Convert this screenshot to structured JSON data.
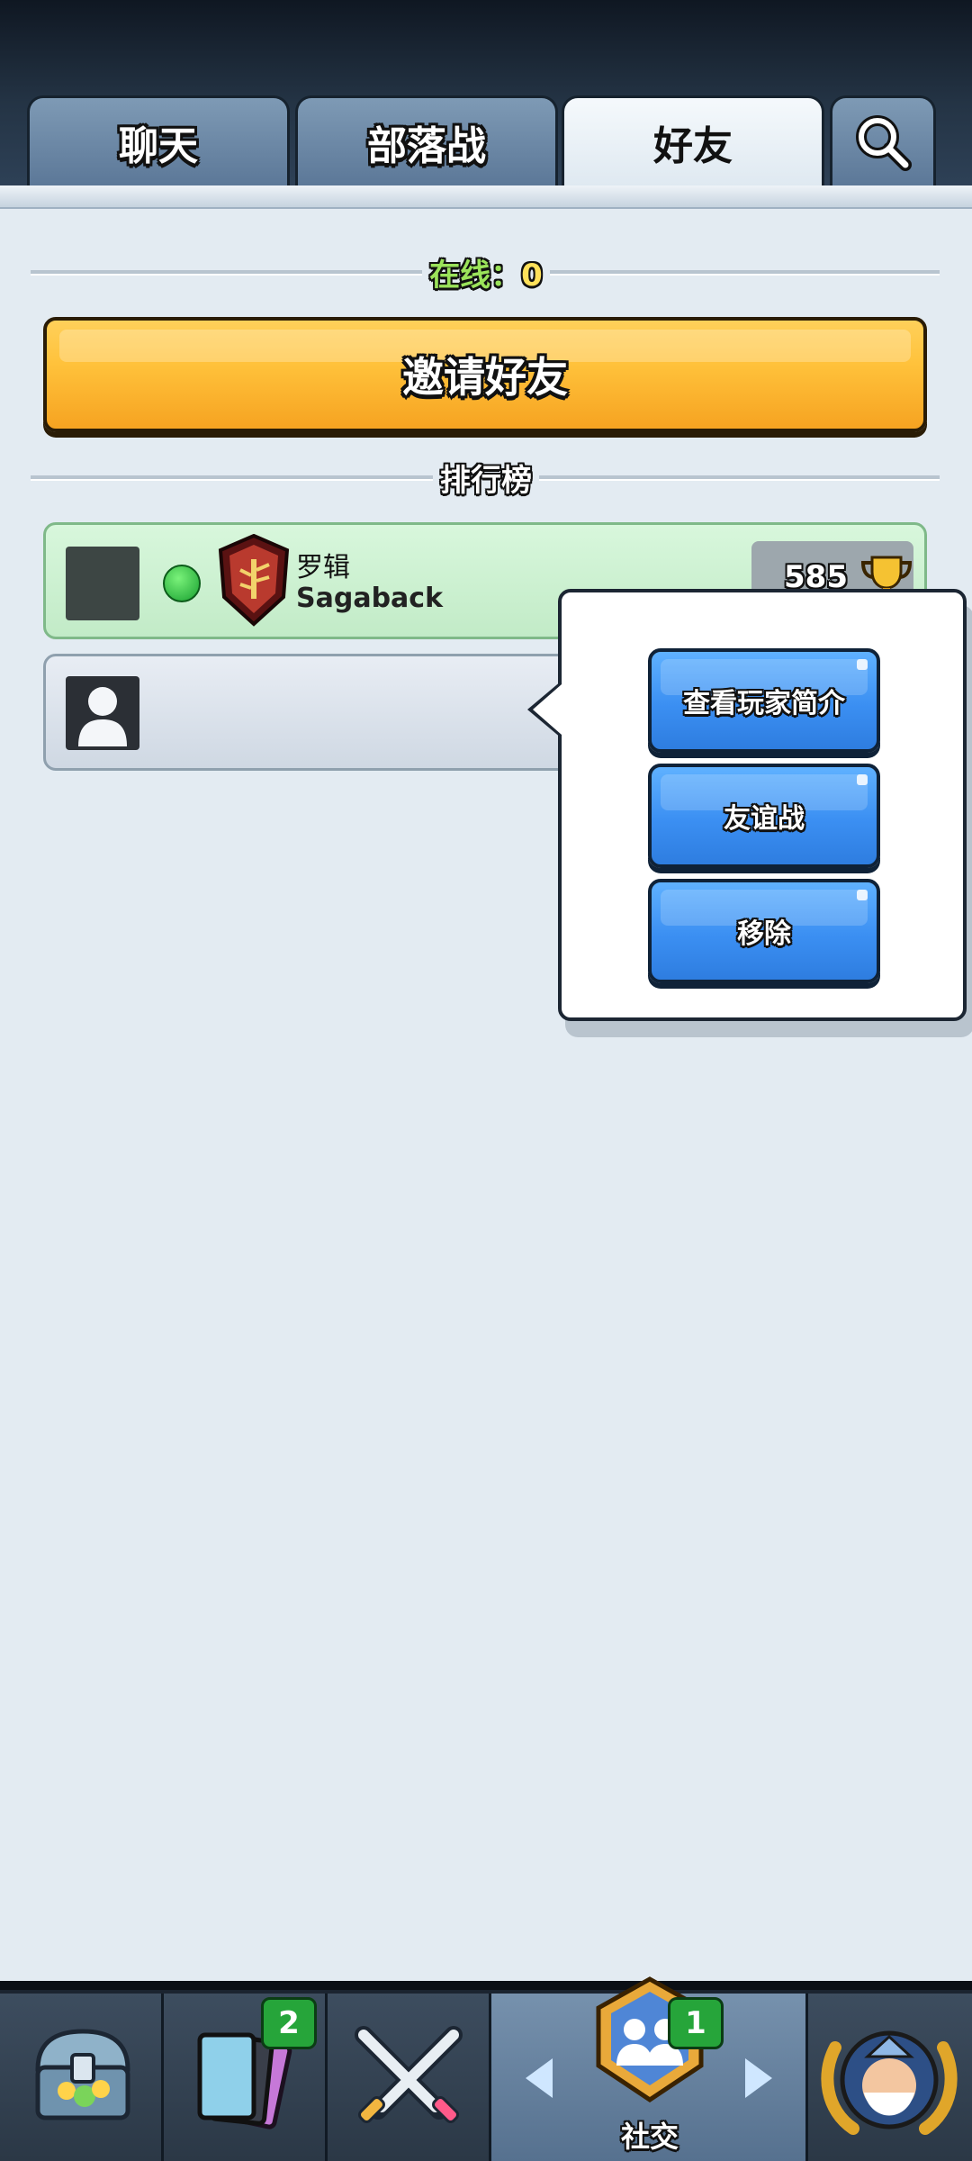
{
  "tabs": [
    {
      "label": "聊天",
      "active": false
    },
    {
      "label": "部落战",
      "active": false
    },
    {
      "label": "好友",
      "active": true
    }
  ],
  "search_icon": "search-icon",
  "online": {
    "label": "在线：",
    "count": "0"
  },
  "invite_button": "邀请好友",
  "leaderboard_label": "排行榜",
  "friends": [
    {
      "name": "罗辑",
      "clan": "Sagaback",
      "trophies": "585",
      "online": true
    },
    {
      "name": "",
      "clan": "",
      "trophies": "",
      "online": false
    }
  ],
  "context_menu": {
    "items": [
      "查看玩家简介",
      "友谊战",
      "移除"
    ]
  },
  "bottom_nav": {
    "items": [
      {
        "icon": "chest-icon",
        "badge": ""
      },
      {
        "icon": "cards-icon",
        "badge": "2"
      },
      {
        "icon": "crossed-swords-icon",
        "badge": ""
      },
      {
        "icon": "social-icon",
        "badge": "1",
        "label": "社交",
        "active": true
      },
      {
        "icon": "king-portrait-icon",
        "badge": ""
      }
    ]
  },
  "colors": {
    "invite_orange": "#ffc23b",
    "menu_blue": "#3b8ff2",
    "online_green": "#9be35a"
  }
}
